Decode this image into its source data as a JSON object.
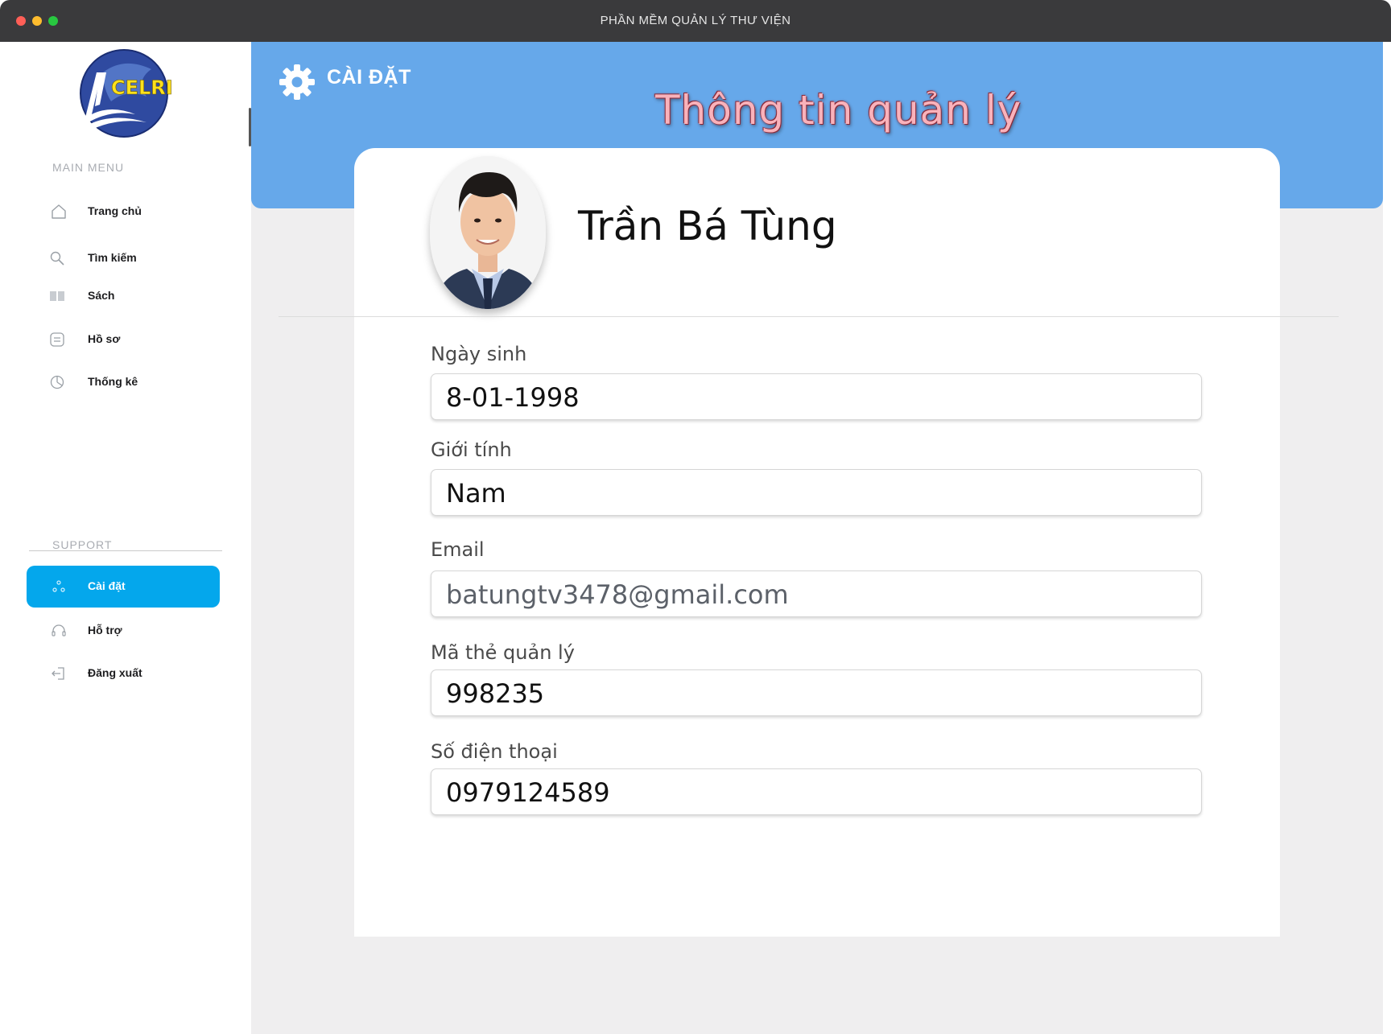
{
  "window": {
    "title": "PHẦN MỀM QUẢN LÝ THƯ VIỆN"
  },
  "brand": {
    "logo_text": "CELRI"
  },
  "sidebar": {
    "main_menu_label": "MAIN MENU",
    "main_items": [
      {
        "label": "Trang chủ",
        "icon": "home-icon"
      },
      {
        "label": "Tìm kiếm",
        "icon": "search-icon"
      },
      {
        "label": "Sách",
        "icon": "book-icon"
      },
      {
        "label": "Hồ sơ",
        "icon": "profile-icon"
      },
      {
        "label": "Thống kê",
        "icon": "stats-icon"
      }
    ],
    "support_label": "SUPPORT",
    "support_items": [
      {
        "label": "Cài đặt",
        "icon": "settings-icon",
        "active": true
      },
      {
        "label": "Hỗ trợ",
        "icon": "headset-icon"
      },
      {
        "label": "Đăng xuất",
        "icon": "logout-icon"
      }
    ]
  },
  "header": {
    "section_title": "CÀI ĐẶT",
    "page_title": "Thông tin quản lý"
  },
  "profile": {
    "name": "Trần Bá Tùng",
    "fields": [
      {
        "label": "Ngày sinh",
        "value": "8-01-1998"
      },
      {
        "label": "Giới tính",
        "value": "Nam"
      },
      {
        "label": "Email",
        "value": "batungtv3478@gmail.com"
      },
      {
        "label": "Mã thẻ quản lý",
        "value": "998235"
      },
      {
        "label": "Số điện thoại",
        "value": "0979124589"
      }
    ]
  },
  "colors": {
    "banner": "#66a8ea",
    "active_nav": "#04a7ec",
    "title_pink": "#f9b2bb"
  }
}
